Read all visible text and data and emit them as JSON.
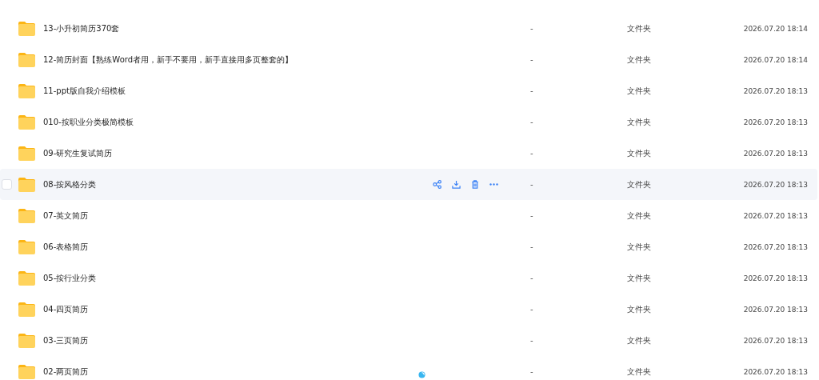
{
  "rows": [
    {
      "name": "13-小升初简历370套",
      "size": "-",
      "type": "文件夹",
      "modified": "2026.07.20 18:14",
      "hovered": false
    },
    {
      "name": "12-简历封面【熟练Word者用，新手不要用，新手直接用多页整套的】",
      "size": "-",
      "type": "文件夹",
      "modified": "2026.07.20 18:14",
      "hovered": false
    },
    {
      "name": "11-ppt版自我介绍模板",
      "size": "-",
      "type": "文件夹",
      "modified": "2026.07.20 18:13",
      "hovered": false
    },
    {
      "name": "010-按职业分类极简模板",
      "size": "-",
      "type": "文件夹",
      "modified": "2026.07.20 18:13",
      "hovered": false
    },
    {
      "name": "09-研究生复试简历",
      "size": "-",
      "type": "文件夹",
      "modified": "2026.07.20 18:13",
      "hovered": false
    },
    {
      "name": "08-按风格分类",
      "size": "-",
      "type": "文件夹",
      "modified": "2026.07.20 18:13",
      "hovered": true
    },
    {
      "name": "07-英文简历",
      "size": "-",
      "type": "文件夹",
      "modified": "2026.07.20 18:13",
      "hovered": false
    },
    {
      "name": "06-表格简历",
      "size": "-",
      "type": "文件夹",
      "modified": "2026.07.20 18:13",
      "hovered": false
    },
    {
      "name": "05-按行业分类",
      "size": "-",
      "type": "文件夹",
      "modified": "2026.07.20 18:13",
      "hovered": false
    },
    {
      "name": "04-四页简历",
      "size": "-",
      "type": "文件夹",
      "modified": "2026.07.20 18:13",
      "hovered": false
    },
    {
      "name": "03-三页简历",
      "size": "-",
      "type": "文件夹",
      "modified": "2026.07.20 18:13",
      "hovered": false
    },
    {
      "name": "02-两页简历",
      "size": "-",
      "type": "文件夹",
      "modified": "2026.07.20 18:13",
      "hovered": false
    }
  ]
}
